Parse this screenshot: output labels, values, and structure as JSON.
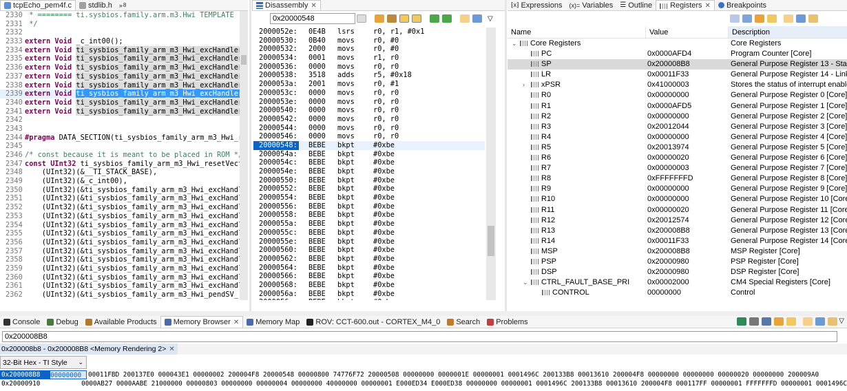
{
  "editor_tabs": [
    {
      "label": "tcpEcho_pem4f.c"
    },
    {
      "label": "stdlib.h"
    },
    {
      "label": "8"
    }
  ],
  "editor": {
    "lines": [
      {
        "num": "2330",
        "text": " * ======== ti.sysbios.family.arm.m3.Hwi TEMPLATE"
      },
      {
        "num": "2331",
        "text": " */"
      },
      {
        "num": "2332",
        "text": ""
      },
      {
        "num": "2333",
        "text": "extern Void _c_int00();"
      },
      {
        "num": "2334",
        "text": "extern Void ti_sysbios_family_arm_m3_Hwi_excHandler"
      },
      {
        "num": "2335",
        "text": "extern Void ti_sysbios_family_arm_m3_Hwi_excHandler"
      },
      {
        "num": "2336",
        "text": "extern Void ti_sysbios_family_arm_m3_Hwi_excHandler"
      },
      {
        "num": "2337",
        "text": "extern Void ti_sysbios_family_arm_m3_Hwi_excHandler"
      },
      {
        "num": "2338",
        "text": "extern Void ti_sysbios_family_arm_m3_Hwi_excHandler"
      },
      {
        "num": "2339",
        "text": "extern Void ti_sysbios_family_arm_m3_Hwi_excHandler"
      },
      {
        "num": "2340",
        "text": "extern Void ti_sysbios_family_arm_m3_Hwi_excHandler"
      },
      {
        "num": "2341",
        "text": "extern Void ti_sysbios_family_arm_m3_Hwi_excHandler"
      },
      {
        "num": "2342",
        "text": ""
      },
      {
        "num": "2343",
        "text": ""
      },
      {
        "num": "2344",
        "text": "#pragma DATA_SECTION(ti_sysbios_family_arm_m3_Hwi_r"
      },
      {
        "num": "2345",
        "text": ""
      },
      {
        "num": "2346",
        "text": "/* const because it is meant to be placed in ROM */"
      },
      {
        "num": "2347",
        "text": "const UInt32 ti_sysbios_family_arm_m3_Hwi_resetVect"
      },
      {
        "num": "2348",
        "text": "    (UInt32)(&__TI_STACK_BASE),"
      },
      {
        "num": "2349",
        "text": "    (UInt32)(&_c_int00),"
      },
      {
        "num": "2350",
        "text": "    (UInt32)(&ti_sysbios_family_arm_m3_Hwi_excHandl"
      },
      {
        "num": "2351",
        "text": "    (UInt32)(&ti_sysbios_family_arm_m3_Hwi_excHandl"
      },
      {
        "num": "2352",
        "text": "    (UInt32)(&ti_sysbios_family_arm_m3_Hwi_excHandl"
      },
      {
        "num": "2353",
        "text": "    (UInt32)(&ti_sysbios_family_arm_m3_Hwi_excHandl"
      },
      {
        "num": "2354",
        "text": "    (UInt32)(&ti_sysbios_family_arm_m3_Hwi_excHandl"
      },
      {
        "num": "2355",
        "text": "    (UInt32)(&ti_sysbios_family_arm_m3_Hwi_excHandl"
      },
      {
        "num": "2356",
        "text": "    (UInt32)(&ti_sysbios_family_arm_m3_Hwi_excHandl"
      },
      {
        "num": "2357",
        "text": "    (UInt32)(&ti_sysbios_family_arm_m3_Hwi_excHandl"
      },
      {
        "num": "2358",
        "text": "    (UInt32)(&ti_sysbios_family_arm_m3_Hwi_excHandl"
      },
      {
        "num": "2359",
        "text": "    (UInt32)(&ti_sysbios_family_arm_m3_Hwi_excHandl"
      },
      {
        "num": "2360",
        "text": "    (UInt32)(&ti_sysbios_family_arm_m3_Hwi_excHandl"
      },
      {
        "num": "2361",
        "text": "    (UInt32)(&ti_sysbios_family_arm_m3_Hwi_excHandl"
      },
      {
        "num": "2362",
        "text": "    (UInt32)(&ti_sysbios_family_arm_m3_Hwi_pendSV_"
      }
    ]
  },
  "disasm": {
    "tab_label": "Disassembly",
    "address_input": "0x20000548",
    "lines": [
      {
        "addr": "2000052e:",
        "hex": "0E4B",
        "op": "lsrs",
        "arg": "r0, r1, #0x1"
      },
      {
        "addr": "20000530:",
        "hex": "0B40",
        "op": "movs",
        "arg": "r0, #0"
      },
      {
        "addr": "20000532:",
        "hex": "2000",
        "op": "movs",
        "arg": "r0, #0"
      },
      {
        "addr": "20000534:",
        "hex": "0001",
        "op": "movs",
        "arg": "r1, r0"
      },
      {
        "addr": "20000536:",
        "hex": "0000",
        "op": "movs",
        "arg": "r0, r0"
      },
      {
        "addr": "20000538:",
        "hex": "3518",
        "op": "adds",
        "arg": "r5, #0x18"
      },
      {
        "addr": "2000053a:",
        "hex": "2001",
        "op": "movs",
        "arg": "r0, #1"
      },
      {
        "addr": "2000053c:",
        "hex": "0000",
        "op": "movs",
        "arg": "r0, r0"
      },
      {
        "addr": "2000053e:",
        "hex": "0000",
        "op": "movs",
        "arg": "r0, r0"
      },
      {
        "addr": "20000540:",
        "hex": "0000",
        "op": "movs",
        "arg": "r0, r0"
      },
      {
        "addr": "20000542:",
        "hex": "0000",
        "op": "movs",
        "arg": "r0, r0"
      },
      {
        "addr": "20000544:",
        "hex": "0000",
        "op": "movs",
        "arg": "r0, r0"
      },
      {
        "addr": "20000546:",
        "hex": "0000",
        "op": "movs",
        "arg": "r0, r0"
      },
      {
        "addr": "20000548:",
        "hex": "BEBE",
        "op": "bkpt",
        "arg": "#0xbe"
      },
      {
        "addr": "2000054a:",
        "hex": "BEBE",
        "op": "bkpt",
        "arg": "#0xbe"
      },
      {
        "addr": "2000054c:",
        "hex": "BEBE",
        "op": "bkpt",
        "arg": "#0xbe"
      },
      {
        "addr": "2000054e:",
        "hex": "BEBE",
        "op": "bkpt",
        "arg": "#0xbe"
      },
      {
        "addr": "20000550:",
        "hex": "BEBE",
        "op": "bkpt",
        "arg": "#0xbe"
      },
      {
        "addr": "20000552:",
        "hex": "BEBE",
        "op": "bkpt",
        "arg": "#0xbe"
      },
      {
        "addr": "20000554:",
        "hex": "BEBE",
        "op": "bkpt",
        "arg": "#0xbe"
      },
      {
        "addr": "20000556:",
        "hex": "BEBE",
        "op": "bkpt",
        "arg": "#0xbe"
      },
      {
        "addr": "20000558:",
        "hex": "BEBE",
        "op": "bkpt",
        "arg": "#0xbe"
      },
      {
        "addr": "2000055a:",
        "hex": "BEBE",
        "op": "bkpt",
        "arg": "#0xbe"
      },
      {
        "addr": "2000055c:",
        "hex": "BEBE",
        "op": "bkpt",
        "arg": "#0xbe"
      },
      {
        "addr": "2000055e:",
        "hex": "BEBE",
        "op": "bkpt",
        "arg": "#0xbe"
      },
      {
        "addr": "20000560:",
        "hex": "BEBE",
        "op": "bkpt",
        "arg": "#0xbe"
      },
      {
        "addr": "20000562:",
        "hex": "BEBE",
        "op": "bkpt",
        "arg": "#0xbe"
      },
      {
        "addr": "20000564:",
        "hex": "BEBE",
        "op": "bkpt",
        "arg": "#0xbe"
      },
      {
        "addr": "20000566:",
        "hex": "BEBE",
        "op": "bkpt",
        "arg": "#0xbe"
      },
      {
        "addr": "20000568:",
        "hex": "BEBE",
        "op": "bkpt",
        "arg": "#0xbe"
      },
      {
        "addr": "2000056a:",
        "hex": "BEBE",
        "op": "bkpt",
        "arg": "#0xbe"
      },
      {
        "addr": "2000056c:",
        "hex": "BEBE",
        "op": "bkpt",
        "arg": "#0xbe"
      },
      {
        "addr": "2000056e:",
        "hex": "BEBE",
        "op": "bkpt",
        "arg": "#0xbe"
      }
    ]
  },
  "right_tabs": [
    {
      "label": "Expressions",
      "prefix": "(x)="
    },
    {
      "label": "Variables",
      "prefix": "(x)="
    },
    {
      "label": "Outline",
      "prefix": ""
    },
    {
      "label": "Registers",
      "prefix": ""
    },
    {
      "label": "Breakpoints",
      "prefix": ""
    }
  ],
  "registers": {
    "headers": {
      "name": "Name",
      "value": "Value",
      "desc": "Description"
    },
    "rows": [
      {
        "name": "Core Registers",
        "value": "",
        "desc": "Core Registers",
        "level": 0,
        "expand": "v",
        "group": true
      },
      {
        "name": "PC",
        "value": "0x0000AFD4",
        "desc": "Program Counter [Core]",
        "level": 1
      },
      {
        "name": "SP",
        "value": "0x200008B8",
        "desc": "General Purpose Register 13 - Stack Po",
        "level": 1
      },
      {
        "name": "LR",
        "value": "0x00011F33",
        "desc": "General Purpose Register 14 - Link Re",
        "level": 1
      },
      {
        "name": "xPSR",
        "value": "0x41000003",
        "desc": "Stores the status of interrupt enables a",
        "level": 1,
        "expand": ">"
      },
      {
        "name": "R0",
        "value": "0x00000000",
        "desc": "General Purpose Register 0 [Core]",
        "level": 1
      },
      {
        "name": "R1",
        "value": "0x0000AFD5",
        "desc": "General Purpose Register 1 [Core]",
        "level": 1
      },
      {
        "name": "R2",
        "value": "0x00000000",
        "desc": "General Purpose Register 2 [Core]",
        "level": 1
      },
      {
        "name": "R3",
        "value": "0x20012044",
        "desc": "General Purpose Register 3 [Core]",
        "level": 1
      },
      {
        "name": "R4",
        "value": "0x00000000",
        "desc": "General Purpose Register 4 [Core]",
        "level": 1
      },
      {
        "name": "R5",
        "value": "0x20013974",
        "desc": "General Purpose Register 5 [Core]",
        "level": 1
      },
      {
        "name": "R6",
        "value": "0x00000020",
        "desc": "General Purpose Register 6 [Core]",
        "level": 1
      },
      {
        "name": "R7",
        "value": "0x00000003",
        "desc": "General Purpose Register 7 [Core]",
        "level": 1
      },
      {
        "name": "R8",
        "value": "0xFFFFFFFD",
        "desc": "General Purpose Register 8 [Core]",
        "level": 1
      },
      {
        "name": "R9",
        "value": "0x00000000",
        "desc": "General Purpose Register 9 [Core]",
        "level": 1
      },
      {
        "name": "R10",
        "value": "0x00000000",
        "desc": "General Purpose Register 10 [Core]",
        "level": 1
      },
      {
        "name": "R11",
        "value": "0x00000020",
        "desc": "General Purpose Register 11 [Core]",
        "level": 1
      },
      {
        "name": "R12",
        "value": "0x20012574",
        "desc": "General Purpose Register 12 [Core]",
        "level": 1
      },
      {
        "name": "R13",
        "value": "0x200008B8",
        "desc": "General Purpose Register 13 [Core]",
        "level": 1
      },
      {
        "name": "R14",
        "value": "0x00011F33",
        "desc": "General Purpose Register 14 [Core]",
        "level": 1
      },
      {
        "name": "MSP",
        "value": "0x200008B8",
        "desc": "MSP Register [Core]",
        "level": 1
      },
      {
        "name": "PSP",
        "value": "0x20000980",
        "desc": "PSP Register [Core]",
        "level": 1
      },
      {
        "name": "DSP",
        "value": "0x20000980",
        "desc": "DSP Register [Core]",
        "level": 1
      },
      {
        "name": "CTRL_FAULT_BASE_PRI",
        "value": "0x00002000",
        "desc": "CM4 Special Registers [Core]",
        "level": 1,
        "expand": "v"
      },
      {
        "name": "CONTROL",
        "value": "00000000",
        "desc": "Control",
        "level": 2
      }
    ]
  },
  "bottom_tabs": [
    {
      "label": "Console"
    },
    {
      "label": "Debug"
    },
    {
      "label": "Available Products"
    },
    {
      "label": "Memory Browser",
      "active": true
    },
    {
      "label": "Memory Map"
    },
    {
      "label": "ROV: CCT-600.out - CORTEX_M4_0"
    },
    {
      "label": "Search"
    },
    {
      "label": "Problems"
    }
  ],
  "memory": {
    "address_input": "0x200008B8",
    "rendering_tab": "0x200008b8 - 0x200008B8 <Memory Rendering 2>",
    "format_select": "32-Bit Hex - TI Style",
    "rows": [
      {
        "addr": "0x200008B8",
        "first": "00000000",
        "rest": "00011FBD 200137E0 000043E1 00000002 200004F8 20000548 00000800 74776F72 20000508 00000000 0000001E 00000001 0001496C 200133B8 00013610 200004F8 00000000 00000000 00000020 00000000 200009A0"
      },
      {
        "addr": "0x20000910",
        "first": "",
        "rest": "0000AB27 0000AABE 21000000 00000803 00000000 00000004 00000000 40000000 00000001 E000ED34 E000ED38 00000000 00000001 0001496C 200133B8 00013610 200004F8 000117FF 00000001 FFFFFFFD 00000001 0001496C"
      }
    ]
  },
  "colors": {
    "selection": "#0a64c8",
    "keyword": "#7f0055",
    "comment": "#3f7f5f"
  }
}
